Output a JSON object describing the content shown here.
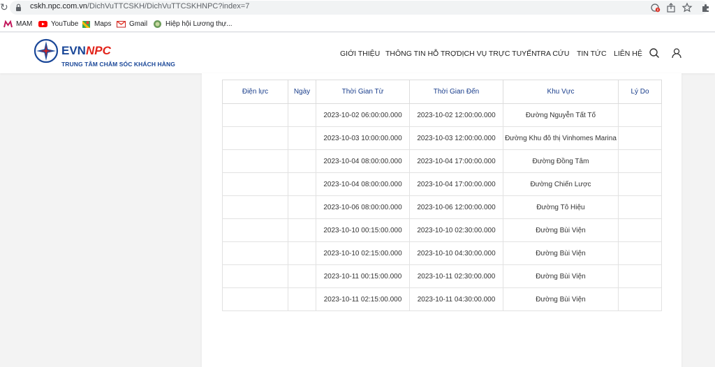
{
  "browser": {
    "url_host": "cskh.npc.com.vn",
    "url_path": "/DichVuTTCSKH/DichVuTTCSKHNPC?index=7",
    "bookmarks": [
      {
        "label": "MAM",
        "icon": "mam-icon"
      },
      {
        "label": "YouTube",
        "icon": "youtube-icon"
      },
      {
        "label": "Maps",
        "icon": "maps-icon"
      },
      {
        "label": "Gmail",
        "icon": "gmail-icon"
      },
      {
        "label": "Hiệp hội Lương thự...",
        "icon": "globe-icon"
      }
    ]
  },
  "header": {
    "logo_evn": "EVN",
    "logo_npc": "NPC",
    "logo_subtitle": "TRUNG TÂM CHĂM SÓC KHÁCH HÀNG",
    "nav": [
      "GIỚI THIỆU",
      "THÔNG TIN HỖ TRỢ",
      "DỊCH VỤ TRỰC TUYẾN",
      "TRA CỨU",
      "TIN TỨC",
      "LIÊN HỆ"
    ]
  },
  "table": {
    "columns": [
      "Điện lực",
      "Ngày",
      "Thời Gian Từ",
      "Thời Gian Đến",
      "Khu Vực",
      "Lý Do"
    ],
    "rows": [
      [
        "",
        "",
        "2023-10-02 06:00:00.000",
        "2023-10-02 12:00:00.000",
        "Đường Nguyễn Tất Tố",
        ""
      ],
      [
        "",
        "",
        "2023-10-03 10:00:00.000",
        "2023-10-03 12:00:00.000",
        "Đường Khu đô thị Vinhomes Marina",
        ""
      ],
      [
        "",
        "",
        "2023-10-04 08:00:00.000",
        "2023-10-04 17:00:00.000",
        "Đường Đồng Tâm",
        ""
      ],
      [
        "",
        "",
        "2023-10-04 08:00:00.000",
        "2023-10-04 17:00:00.000",
        "Đường Chiến Lược",
        ""
      ],
      [
        "",
        "",
        "2023-10-06 08:00:00.000",
        "2023-10-06 12:00:00.000",
        "Đường Tô Hiệu",
        ""
      ],
      [
        "",
        "",
        "2023-10-10 00:15:00.000",
        "2023-10-10 02:30:00.000",
        "Đường Bùi Viện",
        ""
      ],
      [
        "",
        "",
        "2023-10-10 02:15:00.000",
        "2023-10-10 04:30:00.000",
        "Đường Bùi Viện",
        ""
      ],
      [
        "",
        "",
        "2023-10-11 00:15:00.000",
        "2023-10-11 02:30:00.000",
        "Đường Bùi Viện",
        ""
      ],
      [
        "",
        "",
        "2023-10-11 02:15:00.000",
        "2023-10-11 04:30:00.000",
        "Đường Bùi Viện",
        ""
      ]
    ]
  }
}
